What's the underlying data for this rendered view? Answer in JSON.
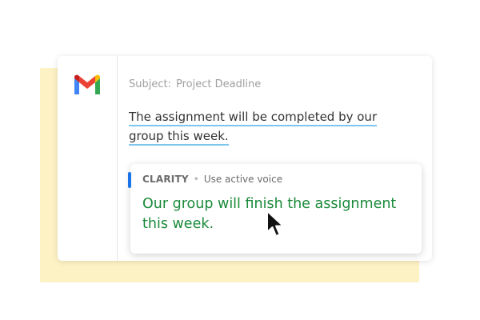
{
  "email": {
    "subject_label": "Subject:",
    "subject_value": "Project Deadline",
    "body_line1": "The assignment will be completed by our",
    "body_line2": "group this week."
  },
  "suggestion": {
    "category": "CLARITY",
    "separator": "•",
    "hint": "Use active voice",
    "text_line1": "Our group will finish the assignment",
    "text_line2": "this week."
  },
  "icons": {
    "logo": "gmail-logo",
    "cursor": "mouse-pointer-icon"
  },
  "colors": {
    "backdrop": "#fdf2c4",
    "underline": "#7cc6ee",
    "suggestion_text": "#1a8a3a",
    "accent": "#1a73e8"
  }
}
